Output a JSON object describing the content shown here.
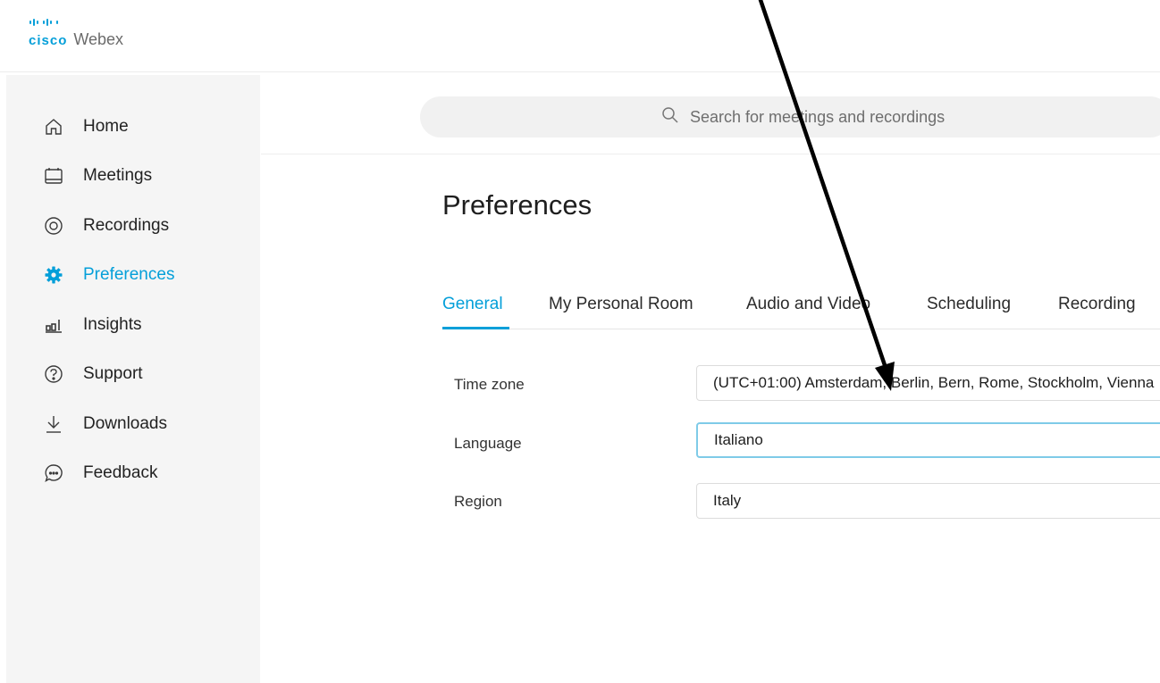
{
  "app": {
    "brand": "cisco",
    "product": "Webex"
  },
  "sidebar": {
    "items": [
      {
        "label": "Home",
        "icon": "home-icon"
      },
      {
        "label": "Meetings",
        "icon": "calendar-icon"
      },
      {
        "label": "Recordings",
        "icon": "recording-icon"
      },
      {
        "label": "Preferences",
        "icon": "gear-icon",
        "active": true
      },
      {
        "label": "Insights",
        "icon": "insights-icon"
      },
      {
        "label": "Support",
        "icon": "help-icon"
      },
      {
        "label": "Downloads",
        "icon": "download-icon"
      },
      {
        "label": "Feedback",
        "icon": "feedback-icon"
      }
    ]
  },
  "search": {
    "placeholder": "Search for meetings and recordings"
  },
  "main": {
    "title": "Preferences",
    "tabs": [
      {
        "label": "General",
        "active": true
      },
      {
        "label": "My Personal Room"
      },
      {
        "label": "Audio and Video"
      },
      {
        "label": "Scheduling"
      },
      {
        "label": "Recording"
      }
    ],
    "fields": [
      {
        "label": "Time zone",
        "value": "(UTC+01:00) Amsterdam, Berlin, Bern, Rome, Stockholm, Vienna"
      },
      {
        "label": "Language",
        "value": "Italiano"
      },
      {
        "label": "Region",
        "value": "Italy"
      }
    ]
  },
  "colors": {
    "accent": "#049fd9",
    "sidebar_bg": "#f5f5f5",
    "arrow": "#000000"
  }
}
